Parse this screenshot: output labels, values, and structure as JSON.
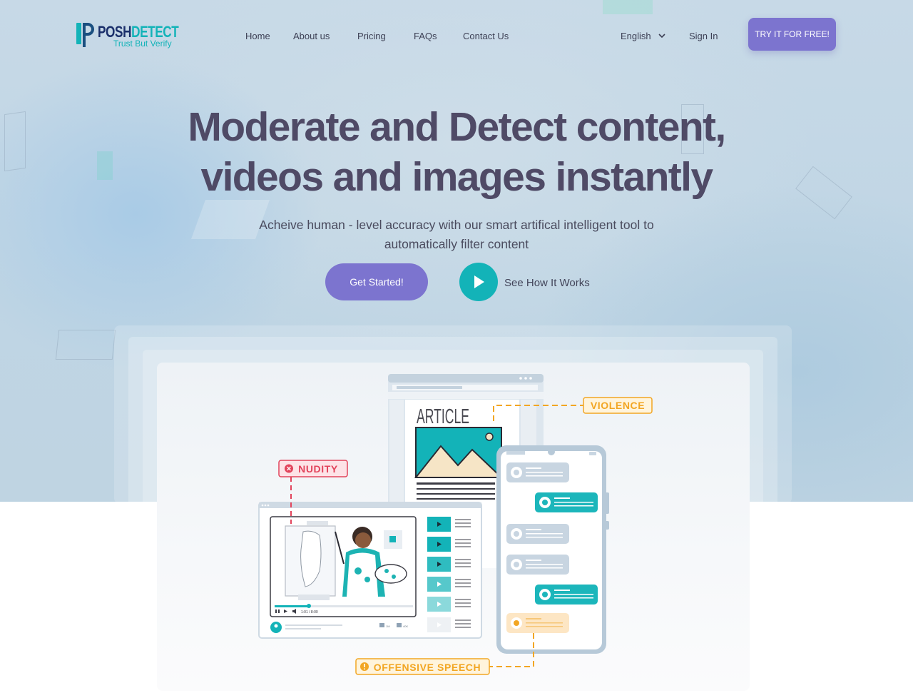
{
  "brand": {
    "name_part1": "POSH",
    "name_part2": "DETECT",
    "tagline": "Trust But Verify"
  },
  "nav": {
    "links": [
      "Home",
      "About us",
      "Pricing",
      "FAQs",
      "Contact Us"
    ],
    "language": "English",
    "signin": "Sign In",
    "cta": "TRY IT FOR FREE!"
  },
  "hero": {
    "headline_line1": "Moderate and Detect content,",
    "headline_line2": "videos and images instantly",
    "subtext_line1": "Acheive human - level accuracy with our smart artifical intelligent tool to",
    "subtext_line2": "automatically filter content",
    "primary_cta": "Get Started!",
    "secondary_cta": "See How It Works"
  },
  "illustration": {
    "article_title": "ARTICLE",
    "tags": {
      "violence": "VIOLENCE",
      "nudity": "NUDITY",
      "offensive": "OFFENSIVE SPEECH"
    },
    "video_time": "1:01 / 8:00",
    "like_count": "1M",
    "dislike_count": "40K"
  },
  "colors": {
    "primary": "#7c74cf",
    "teal": "#13b3b8",
    "heading": "#4f4a66",
    "violence": "#f2a623",
    "nudity": "#e2445c",
    "offensive": "#f2a623"
  }
}
